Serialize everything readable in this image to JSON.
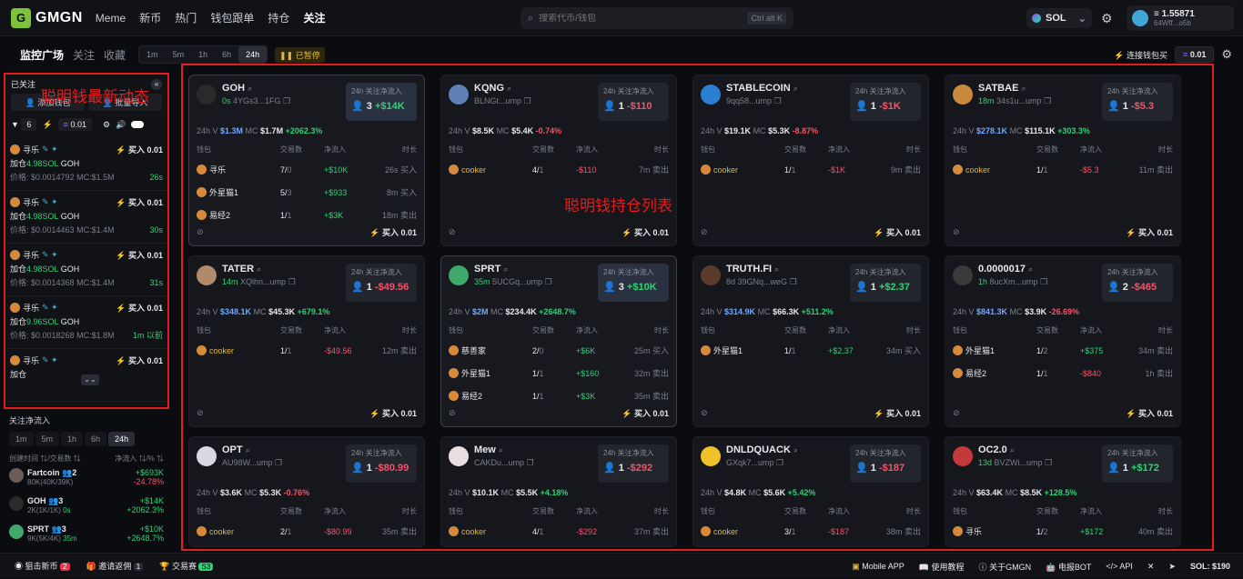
{
  "nav": {
    "logo": "GMGN",
    "items": [
      "Meme",
      "新币",
      "热门",
      "钱包跟单",
      "持仓",
      "关注"
    ],
    "search_placeholder": "搜索代币/钱包",
    "search_kbd": "Ctrl alt K",
    "chain": "SOL",
    "balance": "≡ 1.55871",
    "address": "64Wff...o5b"
  },
  "subbar": {
    "tabs": [
      "监控广场",
      "关注",
      "收藏"
    ],
    "timeframes": [
      "1m",
      "5m",
      "1h",
      "6h",
      "24h"
    ],
    "paused": "已暂停",
    "connect": "连接钱包买",
    "amount": "0.01"
  },
  "annotations": {
    "left": "聪明钱最新动态",
    "main": "聪明钱持仓列表"
  },
  "left_panel": {
    "header": "已关注",
    "add_btn": "添加钱包",
    "import_btn": "批量导入",
    "filter_count": "6",
    "amount": "0.01",
    "items": [
      {
        "user": "寻乐",
        "action": "加仓",
        "amount": "4.98SOL",
        "token": "GOH",
        "price": "价格: $0.0014792",
        "mc": "MC:$1.5M",
        "time": "26s",
        "buy": "买入 0.01"
      },
      {
        "user": "寻乐",
        "action": "加仓",
        "amount": "4.98SOL",
        "token": "GOH",
        "price": "价格: $0.0014463",
        "mc": "MC:$1.4M",
        "time": "30s",
        "buy": "买入 0.01"
      },
      {
        "user": "寻乐",
        "action": "加仓",
        "amount": "4.98SOL",
        "token": "GOH",
        "price": "价格: $0.0014368",
        "mc": "MC:$1.4M",
        "time": "31s",
        "buy": "买入 0.01"
      },
      {
        "user": "寻乐",
        "action": "加仓",
        "amount": "9.96SOL",
        "token": "GOH",
        "price": "价格: $0.0018268",
        "mc": "MC:$1.8M",
        "time": "1m 以前",
        "buy": "买入 0.01"
      },
      {
        "user": "寻乐",
        "action": "加仓",
        "amount": "",
        "token": "",
        "price": "",
        "mc": "",
        "time": "",
        "buy": "买入 0.01"
      }
    ]
  },
  "left_lower": {
    "title": "关注净流入",
    "timeframes": [
      "1m",
      "5m",
      "1h",
      "6h",
      "24h"
    ],
    "head_left": "创建时间 ⇅/交易数 ⇅",
    "head_right": "净流入 ⇅/% ⇅",
    "rows": [
      {
        "name": "Fartcoin",
        "badge": "2",
        "sub": "80K(40K/39K)",
        "val": "+$693K",
        "pct": "-24.78%"
      },
      {
        "name": "GOH",
        "badge": "3",
        "sub": "2K(1K/1K)",
        "time": "0s",
        "val": "+$14K",
        "pct": "+2062.3%"
      },
      {
        "name": "SPRT",
        "badge": "3",
        "sub": "9K(5K/4K)",
        "time": "35m",
        "val": "+$10K",
        "pct": "+2648.7%"
      }
    ]
  },
  "card_labels": {
    "box_title": "24h 关注净流入",
    "wallet": "钱包",
    "trades": "交易数",
    "netflow": "净流入",
    "duration": "时长",
    "buy": "买入 0.01"
  },
  "cards": [
    {
      "name": "GOH",
      "time": "0s",
      "addr": "4YGs3...1FG",
      "box": "3",
      "boxval": "+$14K",
      "boxpos": true,
      "hl": true,
      "vol": "$1.3M",
      "mc": "$1.7M",
      "chg": "+2062.3%",
      "color": "#2a2a2a",
      "rows": [
        {
          "w": "寻乐",
          "t1": "7",
          "t2": "0",
          "f": "+$10K",
          "d": "26s 买入"
        },
        {
          "w": "外星猫1",
          "t1": "5",
          "t2": "3",
          "f": "+$933",
          "d": "8m 买入"
        },
        {
          "w": "易经2",
          "t1": "1",
          "t2": "1",
          "f": "+$3K",
          "d": "18m 卖出"
        }
      ]
    },
    {
      "name": "KQNG",
      "time": "",
      "addr": "BLNGt...ump",
      "box": "1",
      "boxval": "-$110",
      "boxpos": false,
      "vol": "$8.5K",
      "mc": "$5.4K",
      "chg": "-0.74%",
      "color": "#5d7fb3",
      "rows": [
        {
          "w": "cooker",
          "t1": "4",
          "t2": "1",
          "f": "-$110",
          "d": "7m 卖出"
        }
      ]
    },
    {
      "name": "STABLECOIN",
      "time": "",
      "addr": "9qq58...ump",
      "box": "1",
      "boxval": "-$1K",
      "boxpos": false,
      "vol": "$19.1K",
      "mc": "$5.3K",
      "chg": "-8.87%",
      "color": "#2b7fd3",
      "rows": [
        {
          "w": "cooker",
          "t1": "1",
          "t2": "1",
          "f": "-$1K",
          "d": "9m 卖出"
        }
      ]
    },
    {
      "name": "SATBAE",
      "time": "18m",
      "addr": "34s1u...ump",
      "box": "1",
      "boxval": "-$5.3",
      "boxpos": false,
      "vol": "$278.1K",
      "mc": "$115.1K",
      "chg": "+303.3%",
      "color": "#c98a3b",
      "rows": [
        {
          "w": "cooker",
          "t1": "1",
          "t2": "1",
          "f": "-$5.3",
          "d": "11m 卖出"
        }
      ]
    },
    {
      "name": "TATER",
      "time": "14m",
      "addr": "XQihn...ump",
      "box": "1",
      "boxval": "-$49.56",
      "boxpos": false,
      "vol": "$348.1K",
      "mc": "$45.3K",
      "chg": "+679.1%",
      "color": "#b08a6a",
      "rows": [
        {
          "w": "cooker",
          "t1": "1",
          "t2": "1",
          "f": "-$49.56",
          "d": "12m 卖出"
        }
      ]
    },
    {
      "name": "SPRT",
      "time": "35m",
      "addr": "5UCGq...ump",
      "box": "3",
      "boxval": "+$10K",
      "boxpos": true,
      "hl": true,
      "vol": "$2M",
      "mc": "$234.4K",
      "chg": "+2648.7%",
      "color": "#3fa86b",
      "rows": [
        {
          "w": "慈善家",
          "t1": "2",
          "t2": "0",
          "f": "+$6K",
          "d": "25m 买入"
        },
        {
          "w": "外星猫1",
          "t1": "1",
          "t2": "1",
          "f": "+$160",
          "d": "32m 卖出"
        },
        {
          "w": "易经2",
          "t1": "1",
          "t2": "1",
          "f": "+$3K",
          "d": "35m 卖出"
        }
      ]
    },
    {
      "name": "TRUTH.FI",
      "time": "",
      "addr": "8d 39GNq...weG",
      "box": "1",
      "boxval": "+$2.37",
      "boxpos": true,
      "vol": "$314.9K",
      "mc": "$66.3K",
      "chg": "+511.2%",
      "color": "#5a3b2a",
      "rows": [
        {
          "w": "外星猫1",
          "t1": "1",
          "t2": "1",
          "f": "+$2.37",
          "d": "34m 买入"
        }
      ]
    },
    {
      "name": "0.0000017",
      "time": "1h",
      "addr": "8ucXm...ump",
      "box": "2",
      "boxval": "-$465",
      "boxpos": false,
      "vol": "$841.3K",
      "mc": "$3.9K",
      "chg": "-26.69%",
      "color": "#3a3a3a",
      "rows": [
        {
          "w": "外星猫1",
          "t1": "1",
          "t2": "2",
          "f": "+$375",
          "d": "34m 卖出"
        },
        {
          "w": "易经2",
          "t1": "1",
          "t2": "1",
          "f": "-$840",
          "d": "1h 卖出"
        }
      ]
    },
    {
      "name": "OPT",
      "time": "",
      "addr": "AU98W...ump",
      "box": "1",
      "boxval": "-$80.99",
      "boxpos": false,
      "vol": "$3.6K",
      "mc": "$5.3K",
      "chg": "-0.76%",
      "color": "#d8d8e0",
      "rows": [
        {
          "w": "cooker",
          "t1": "2",
          "t2": "1",
          "f": "-$80.99",
          "d": "35m 卖出"
        }
      ]
    },
    {
      "name": "Mew",
      "time": "",
      "addr": "CAKDu...ump",
      "box": "1",
      "boxval": "-$292",
      "boxpos": false,
      "vol": "$10.1K",
      "mc": "$5.5K",
      "chg": "+4.18%",
      "color": "#e8e0e0",
      "rows": [
        {
          "w": "cooker",
          "t1": "4",
          "t2": "1",
          "f": "-$292",
          "d": "37m 卖出"
        }
      ]
    },
    {
      "name": "DNLDQUACK",
      "time": "",
      "addr": "GXqk7...ump",
      "box": "1",
      "boxval": "-$187",
      "boxpos": false,
      "vol": "$4.8K",
      "mc": "$5.6K",
      "chg": "+5.42%",
      "color": "#f0c22a",
      "rows": [
        {
          "w": "cooker",
          "t1": "3",
          "t2": "1",
          "f": "-$187",
          "d": "38m 卖出"
        }
      ]
    },
    {
      "name": "OC2.0",
      "time": "13d",
      "addr": "BVZWi...ump",
      "box": "1",
      "boxval": "+$172",
      "boxpos": true,
      "vol": "$63.4K",
      "mc": "$8.5K",
      "chg": "+128.5%",
      "color": "#c43a3a",
      "rows": [
        {
          "w": "寻乐",
          "t1": "1",
          "t2": "2",
          "f": "+$172",
          "d": "40m 卖出"
        }
      ]
    }
  ],
  "footer": {
    "left": [
      {
        "label": "狙击新币",
        "badge": "2"
      },
      {
        "label": "邀请返佣",
        "badge": "1"
      },
      {
        "label": "交易赛",
        "badge": "S3"
      }
    ],
    "right": [
      "Mobile APP",
      "使用教程",
      "关于GMGN",
      "电报BOT",
      "API"
    ],
    "sol": "SOL: $190"
  }
}
